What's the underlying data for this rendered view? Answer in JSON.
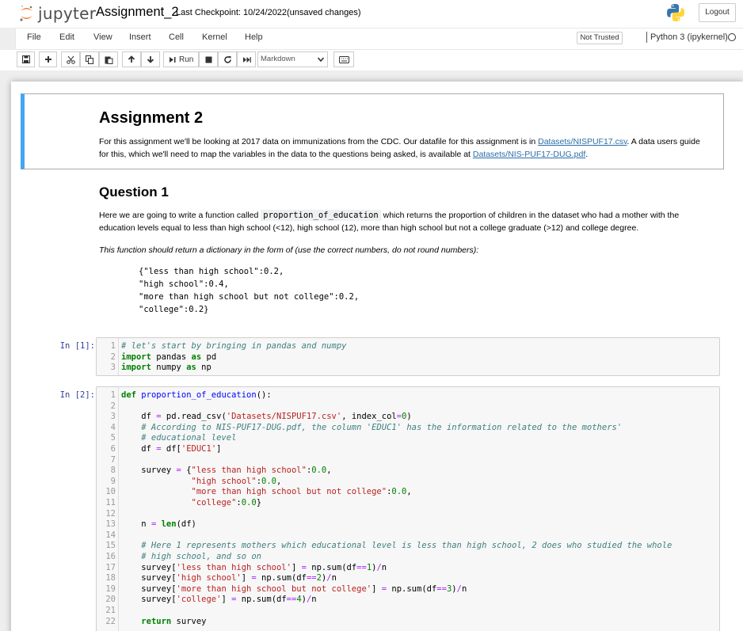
{
  "header": {
    "logo_text": "jupyter",
    "notebook_name": "Assignment_2",
    "checkpoint": "Last Checkpoint: 10/24/2022",
    "autosave_status": "(unsaved changes)",
    "logout_label": "Logout"
  },
  "menubar": {
    "items": [
      "File",
      "Edit",
      "View",
      "Insert",
      "Cell",
      "Kernel",
      "Help"
    ],
    "trust_status": "Not Trusted",
    "kernel_name": "Python 3 (ipykernel)"
  },
  "toolbar": {
    "run_label": "Run",
    "cell_type": "Markdown"
  },
  "cells": {
    "intro": {
      "heading": "Assignment 2",
      "p1_before": "For this assignment we'll be looking at 2017 data on immunizations from the CDC. Our datafile for this assignment is in ",
      "p1_link1": "Datasets/NISPUF17.csv",
      "p1_middle": ". A data users guide for this, which we'll need to map the variables in the data to the questions being asked, is available at ",
      "p1_link2": "Datasets/NIS-PUF17-DUG.pdf",
      "p1_after": "."
    },
    "question1": {
      "heading": "Question 1",
      "p1_before": "Here we are going to write a function called ",
      "p1_code": "proportion_of_education",
      "p1_after": " which returns the proportion of children in the dataset who had a mother with the education levels equal to less than high school (<12), high school (12), more than high school but not a college graduate (>12) and college degree.",
      "p2": "This function should return a dictionary in the form of (use the correct numbers, do not round numbers):",
      "example": "{\"less than high school\":0.2,\n\"high school\":0.4,\n\"more than high school but not college\":0.2,\n\"college\":0.2}"
    },
    "code1": {
      "prompt": "In [1]:",
      "lines": [
        [
          [
            "cm",
            "# let's start by bringing in pandas and numpy"
          ]
        ],
        [
          [
            "kw",
            "import"
          ],
          [
            "",
            " pandas "
          ],
          [
            "kw",
            "as"
          ],
          [
            "",
            " pd"
          ]
        ],
        [
          [
            "kw",
            "import"
          ],
          [
            "",
            " numpy "
          ],
          [
            "kw",
            "as"
          ],
          [
            "",
            " np"
          ]
        ]
      ]
    },
    "code2": {
      "prompt": "In [2]:",
      "lines": [
        [
          [
            "kw",
            "def"
          ],
          [
            "",
            " "
          ],
          [
            "fn",
            "proportion_of_education"
          ],
          [
            "",
            "():"
          ]
        ],
        [],
        [
          [
            "",
            "    df "
          ],
          [
            "op",
            "="
          ],
          [
            "",
            " pd.read_csv("
          ],
          [
            "st",
            "'Datasets/NISPUF17.csv'"
          ],
          [
            "",
            ", index_col"
          ],
          [
            "op",
            "="
          ],
          [
            "nu",
            "0"
          ],
          [
            "",
            ")"
          ]
        ],
        [
          [
            "cm",
            "    # According to NIS-PUF17-DUG.pdf, the column 'EDUC1' has the information related to the mothers'"
          ]
        ],
        [
          [
            "cm",
            "    # educational level"
          ]
        ],
        [
          [
            "",
            "    df "
          ],
          [
            "op",
            "="
          ],
          [
            "",
            " df["
          ],
          [
            "st",
            "'EDUC1'"
          ],
          [
            "",
            "]"
          ]
        ],
        [],
        [
          [
            "",
            "    survey "
          ],
          [
            "op",
            "="
          ],
          [
            "",
            " {"
          ],
          [
            "st",
            "\"less than high school\""
          ],
          [
            "",
            ":"
          ],
          [
            "nu",
            "0.0"
          ],
          [
            "",
            ","
          ]
        ],
        [
          [
            "",
            "              "
          ],
          [
            "st",
            "\"high school\""
          ],
          [
            "",
            ":"
          ],
          [
            "nu",
            "0.0"
          ],
          [
            "",
            ","
          ]
        ],
        [
          [
            "",
            "              "
          ],
          [
            "st",
            "\"more than high school but not college\""
          ],
          [
            "",
            ":"
          ],
          [
            "nu",
            "0.0"
          ],
          [
            "",
            ","
          ]
        ],
        [
          [
            "",
            "              "
          ],
          [
            "st",
            "\"college\""
          ],
          [
            "",
            ":"
          ],
          [
            "nu",
            "0.0"
          ],
          [
            "",
            "}"
          ]
        ],
        [],
        [
          [
            "",
            "    n "
          ],
          [
            "op",
            "="
          ],
          [
            "",
            " "
          ],
          [
            "kw",
            "len"
          ],
          [
            "",
            "(df)"
          ]
        ],
        [],
        [
          [
            "cm",
            "    # Here 1 represents mothers which educational level is less than high school, 2 does who studied the whole"
          ]
        ],
        [
          [
            "cm",
            "    # high school, and so on"
          ]
        ],
        [
          [
            "",
            "    survey["
          ],
          [
            "st",
            "'less than high school'"
          ],
          [
            "",
            "] "
          ],
          [
            "op",
            "="
          ],
          [
            "",
            " np.sum(df"
          ],
          [
            "op",
            "=="
          ],
          [
            "nu",
            "1"
          ],
          [
            "",
            ")"
          ],
          [
            "op",
            "/"
          ],
          [
            "",
            "n"
          ]
        ],
        [
          [
            "",
            "    survey["
          ],
          [
            "st",
            "'high school'"
          ],
          [
            "",
            "] "
          ],
          [
            "op",
            "="
          ],
          [
            "",
            " np.sum(df"
          ],
          [
            "op",
            "=="
          ],
          [
            "nu",
            "2"
          ],
          [
            "",
            ")"
          ],
          [
            "op",
            "/"
          ],
          [
            "",
            "n"
          ]
        ],
        [
          [
            "",
            "    survey["
          ],
          [
            "st",
            "'more than high school but not college'"
          ],
          [
            "",
            "] "
          ],
          [
            "op",
            "="
          ],
          [
            "",
            " np.sum(df"
          ],
          [
            "op",
            "=="
          ],
          [
            "nu",
            "3"
          ],
          [
            "",
            ")"
          ],
          [
            "op",
            "/"
          ],
          [
            "",
            "n"
          ]
        ],
        [
          [
            "",
            "    survey["
          ],
          [
            "st",
            "'college'"
          ],
          [
            "",
            "] "
          ],
          [
            "op",
            "="
          ],
          [
            "",
            " np.sum(df"
          ],
          [
            "op",
            "=="
          ],
          [
            "nu",
            "4"
          ],
          [
            "",
            ")"
          ],
          [
            "op",
            "/"
          ],
          [
            "",
            "n"
          ]
        ],
        [],
        [
          [
            "",
            "    "
          ],
          [
            "kw",
            "return"
          ],
          [
            "",
            " survey"
          ]
        ]
      ]
    }
  }
}
